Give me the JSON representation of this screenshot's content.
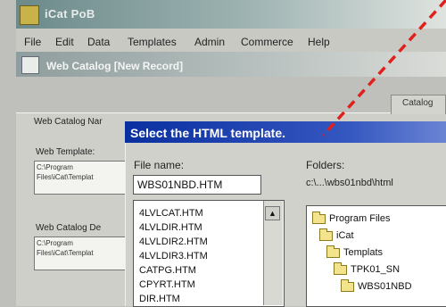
{
  "app": {
    "title": "iCat PoB"
  },
  "menu": [
    {
      "label": "File"
    },
    {
      "label": "Edit"
    },
    {
      "label": "Data"
    },
    {
      "label": "Templates"
    },
    {
      "label": "Admin"
    },
    {
      "label": "Commerce"
    },
    {
      "label": "Help"
    }
  ],
  "document": {
    "title": "Web Catalog  [New Record]"
  },
  "tab": {
    "label": "Catalog"
  },
  "form": {
    "catalog_name_label": "Web Catalog Nar",
    "template_label": "Web Template:",
    "template_value_line1": "C:\\Program",
    "template_value_line2": "Files\\iCat\\Templat",
    "desc_label": "Web Catalog De",
    "desc_value_line1": "C:\\Program",
    "desc_value_line2": "Files\\iCat\\Templat"
  },
  "dialog": {
    "title": "Select the HTML template.",
    "file_name_label": "File name:",
    "file_name_value": "WBS01NBD.HTM",
    "files": [
      "4LVLCAT.HTM",
      "4LVLDIR.HTM",
      "4LVLDIR2.HTM",
      "4LVLDIR3.HTM",
      "CATPG.HTM",
      "CPYRT.HTM",
      "DIR.HTM"
    ],
    "folders_label": "Folders:",
    "folders_path": "c:\\...\\wbs01nbd\\html",
    "folders": [
      "Program Files",
      "iCat",
      "Templats",
      "TPK01_SN",
      "WBS01NBD"
    ]
  },
  "colors": {
    "dialog_title_bg": "#0a2fa0",
    "dash_line": "#e0201a"
  },
  "icons": {
    "scroll_up": "▲",
    "folder": "folder-open-icon"
  }
}
